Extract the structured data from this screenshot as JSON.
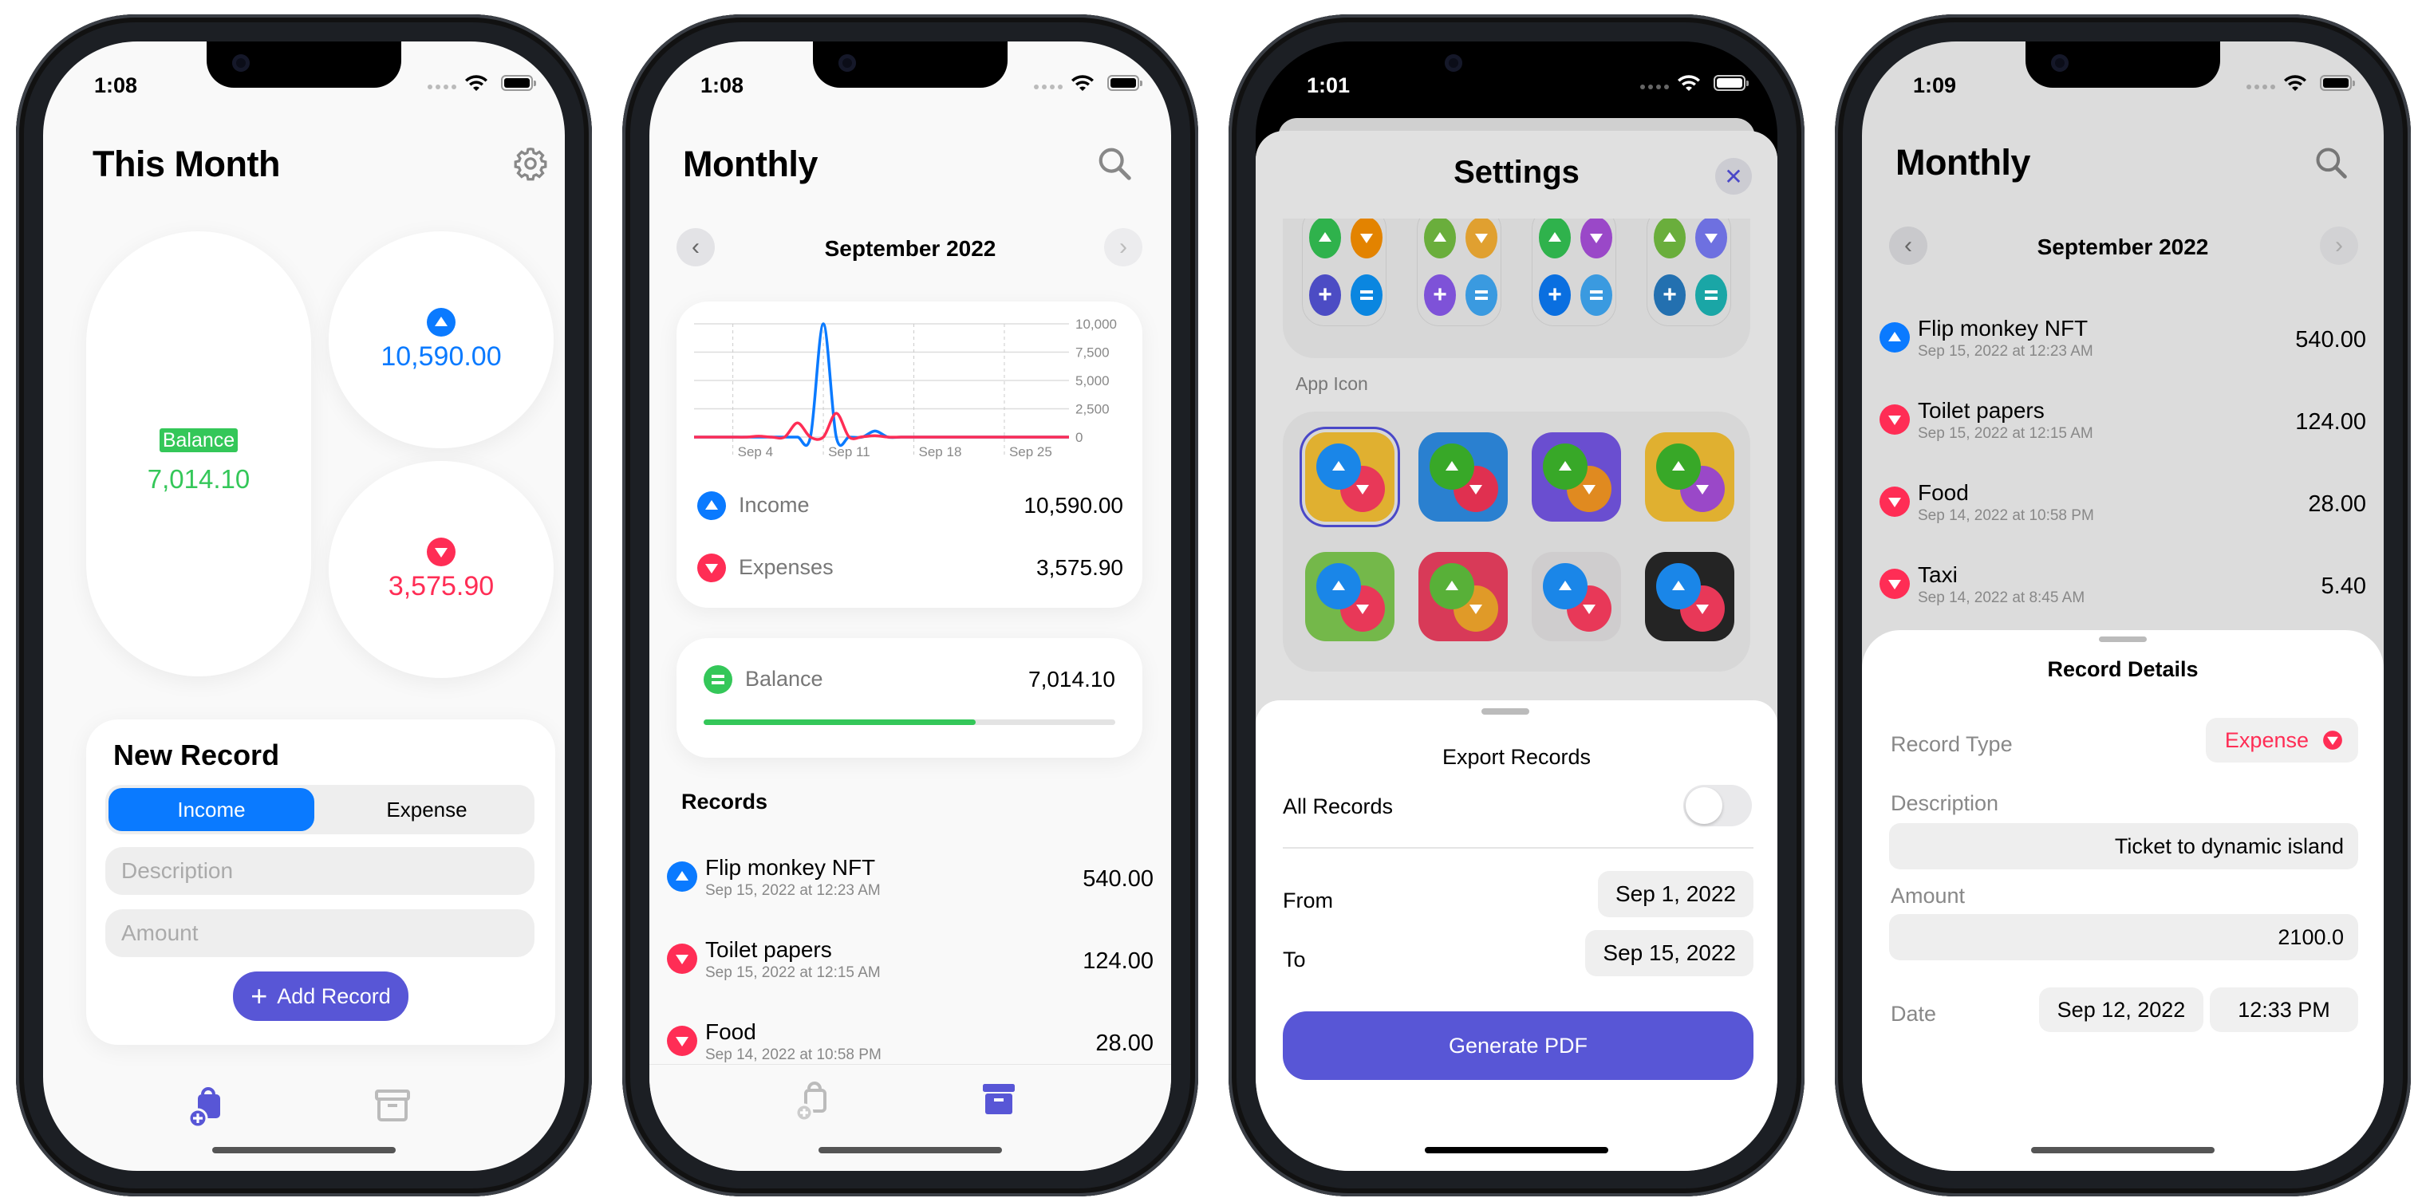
{
  "colors": {
    "accent": "#5856d6",
    "income": "#0a7aff",
    "expense": "#ff2d55",
    "balance": "#34c759"
  },
  "screen1": {
    "time": "1:08",
    "title": "This Month",
    "settings_icon": "gear-icon",
    "balance_label": "Balance",
    "balance_value": "7,014.10",
    "income_value": "10,590.00",
    "expense_value": "3,575.90",
    "new_record": {
      "title": "New Record",
      "segments": [
        "Income",
        "Expense"
      ],
      "selected": "Income",
      "description_placeholder": "Description",
      "amount_placeholder": "Amount",
      "add_label": "Add Record"
    },
    "tabs": [
      {
        "icon": "bag-plus-icon",
        "active": true
      },
      {
        "icon": "archive-box-icon",
        "active": false
      }
    ]
  },
  "screen2": {
    "time": "1:08",
    "title": "Monthly",
    "search_icon": "magnifier-icon",
    "month": "September 2022",
    "income_label": "Income",
    "income_value": "10,590.00",
    "expenses_label": "Expenses",
    "expenses_value": "3,575.90",
    "balance_label": "Balance",
    "balance_value": "7,014.10",
    "balance_progress": 0.66,
    "records_header": "Records",
    "records": [
      {
        "type": "income",
        "name": "Flip monkey NFT",
        "date": "Sep 15, 2022 at 12:23 AM",
        "amount": "540.00"
      },
      {
        "type": "expense",
        "name": "Toilet papers",
        "date": "Sep 15, 2022 at 12:15 AM",
        "amount": "124.00"
      },
      {
        "type": "expense",
        "name": "Food",
        "date": "Sep 14, 2022 at 10:58 PM",
        "amount": "28.00"
      }
    ],
    "tabs": [
      {
        "icon": "bag-plus-icon",
        "active": false
      },
      {
        "icon": "archive-box-icon",
        "active": true
      }
    ]
  },
  "chart_data": {
    "type": "line",
    "title": "",
    "xlabel": "",
    "ylabel": "",
    "x": [
      1,
      2,
      3,
      4,
      5,
      6,
      7,
      8,
      9,
      10,
      11,
      12,
      13,
      14,
      15,
      16,
      17,
      18,
      19,
      20,
      21,
      22,
      23,
      24,
      25,
      26,
      27,
      28,
      29,
      30
    ],
    "xtick_labels": [
      "Sep 4",
      "Sep 11",
      "Sep 18",
      "Sep 25"
    ],
    "xticks": [
      4,
      11,
      18,
      25
    ],
    "yticks": [
      0,
      2500,
      5000,
      7500,
      10000
    ],
    "ytick_labels": [
      "0",
      "2,500",
      "5,000",
      "7,500",
      "10,000"
    ],
    "ylim": [
      0,
      10000
    ],
    "grid": true,
    "series": [
      {
        "name": "Income",
        "color": "#0a7aff",
        "values": [
          0,
          0,
          0,
          0,
          0,
          0,
          0,
          0,
          0,
          0,
          10000,
          0,
          0,
          0,
          540,
          0,
          0,
          0,
          0,
          0,
          0,
          0,
          0,
          0,
          0,
          0,
          0,
          0,
          0,
          0
        ]
      },
      {
        "name": "Expenses",
        "color": "#ff2d55",
        "values": [
          0,
          0,
          0,
          0,
          0,
          80,
          0,
          0,
          1250,
          0,
          0,
          2100,
          0,
          28,
          124,
          0,
          0,
          0,
          0,
          0,
          0,
          0,
          0,
          0,
          0,
          0,
          0,
          0,
          0,
          0
        ]
      }
    ]
  },
  "screen3": {
    "time": "1:01",
    "title": "Settings",
    "close_icon": "close-icon",
    "theme_rows": [
      [
        [
          "#4c4cc4",
          "#2fb24c"
        ],
        [
          "#2370b0",
          "#1aa6a6"
        ],
        [
          "#0a6fe0",
          "#e38300"
        ],
        [
          "#1aa6a6",
          "#e0a030"
        ]
      ],
      [
        [
          "#2fb24c",
          "#e38300",
          "#4c4cc4",
          "#0a86e0"
        ],
        [
          "#6aae3c",
          "#e0a030",
          "#7e52d8",
          "#3a9ae0"
        ],
        [
          "#2fb24c",
          "#9a48c8",
          "#0a6fe0",
          "#3a9ae0"
        ],
        [
          "#6aae3c",
          "#6e70e0",
          "#2370b0",
          "#1aa6a6"
        ]
      ]
    ],
    "app_icon_label": "App Icon",
    "app_icons": [
      {
        "bg": "#e0b030",
        "up": "#1a86e8",
        "down": "#e83858",
        "selected": true
      },
      {
        "bg": "#2a80d0",
        "up": "#38a828",
        "down": "#e03050",
        "selected": false
      },
      {
        "bg": "#6a4ed0",
        "up": "#38a828",
        "down": "#e08a20",
        "selected": false
      },
      {
        "bg": "#e0b030",
        "up": "#38a828",
        "down": "#9a48c8",
        "selected": false
      },
      {
        "bg": "#74b84a",
        "up": "#1a86e8",
        "down": "#e83858",
        "selected": false
      },
      {
        "bg": "#d83a58",
        "up": "#58b038",
        "down": "#e09a28",
        "selected": false
      },
      {
        "bg": "#cfcdce",
        "up": "#1a86e8",
        "down": "#e83858",
        "selected": false
      },
      {
        "bg": "#242424",
        "up": "#1a86e8",
        "down": "#e83858",
        "selected": false
      }
    ],
    "export": {
      "title": "Export Records",
      "all_records_label": "All Records",
      "all_records_on": false,
      "from_label": "From",
      "from_value": "Sep 1, 2022",
      "to_label": "To",
      "to_value": "Sep 15, 2022",
      "generate_label": "Generate PDF"
    }
  },
  "screen4": {
    "time": "1:09",
    "title": "Monthly",
    "month": "September 2022",
    "records": [
      {
        "type": "income",
        "name": "Flip monkey NFT",
        "date": "Sep 15, 2022 at 12:23 AM",
        "amount": "540.00"
      },
      {
        "type": "expense",
        "name": "Toilet papers",
        "date": "Sep 15, 2022 at 12:15 AM",
        "amount": "124.00"
      },
      {
        "type": "expense",
        "name": "Food",
        "date": "Sep 14, 2022 at 10:58 PM",
        "amount": "28.00"
      },
      {
        "type": "expense",
        "name": "Taxi",
        "date": "Sep 14, 2022 at 8:45 AM",
        "amount": "5.40"
      }
    ],
    "details": {
      "title": "Record Details",
      "type_label": "Record Type",
      "type_value": "Expense",
      "description_label": "Description",
      "description_value": "Ticket to dynamic island",
      "amount_label": "Amount",
      "amount_value": "2100.0",
      "date_label": "Date",
      "date_value": "Sep 12, 2022",
      "time_value": "12:33 PM"
    }
  }
}
